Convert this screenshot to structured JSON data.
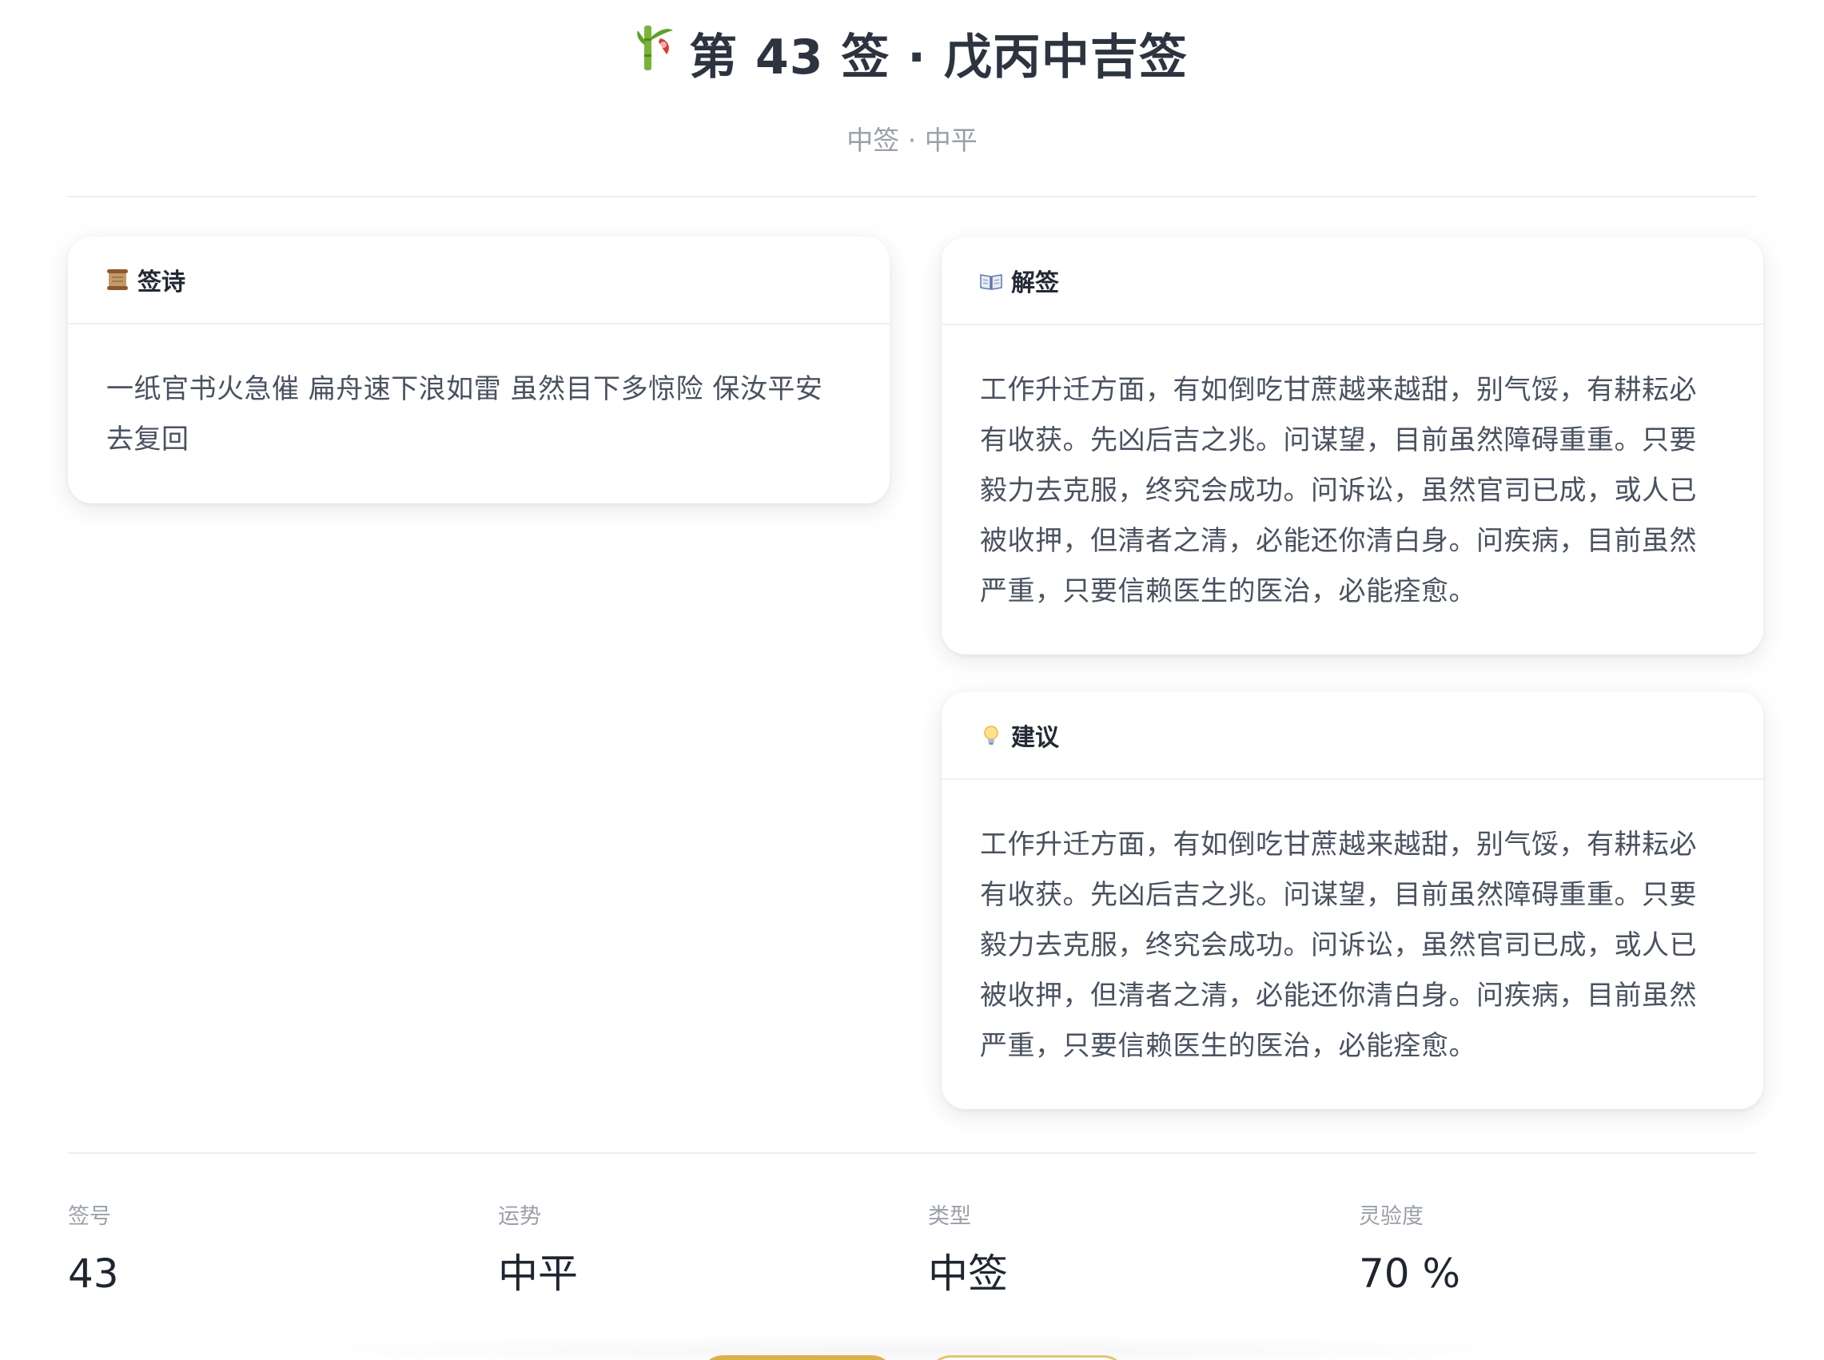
{
  "header": {
    "title": "第 43 签 · 戊丙中吉签",
    "subtitle": "中签 · 中平"
  },
  "cards": {
    "poem": {
      "icon": "scroll-icon",
      "title": "签诗",
      "text": "一纸官书火急催 扁舟速下浪如雷 虽然目下多惊险 保汝平安去复回"
    },
    "interpretation": {
      "icon": "open-book-icon",
      "title": "解签",
      "text": "工作升迁方面，有如倒吃甘蔗越来越甜，别气馁，有耕耘必有收获。先凶后吉之兆。问谋望，目前虽然障碍重重。只要毅力去克服，终究会成功。问诉讼，虽然官司已成，或人已被收押，但清者之清，必能还你清白身。问疾病，目前虽然严重，只要信赖医生的医治，必能痊愈。"
    },
    "advice": {
      "icon": "light-bulb-icon",
      "title": "建议",
      "text": "工作升迁方面，有如倒吃甘蔗越来越甜，别气馁，有耕耘必有收获。先凶后吉之兆。问谋望，目前虽然障碍重重。只要毅力去克服，终究会成功。问诉讼，虽然官司已成，或人已被收押，但清者之清，必能还你清白身。问疾病，目前虽然严重，只要信赖医生的医治，必能痊愈。"
    }
  },
  "stats": [
    {
      "label": "签号",
      "value": "43"
    },
    {
      "label": "运势",
      "value": "中平"
    },
    {
      "label": "类型",
      "value": "中签"
    },
    {
      "label": "灵验度",
      "value": "70 %"
    }
  ],
  "colors": {
    "accent_gold": "#d9b24a",
    "text_dark": "#2d3440",
    "text_muted": "#9aa0a8"
  }
}
